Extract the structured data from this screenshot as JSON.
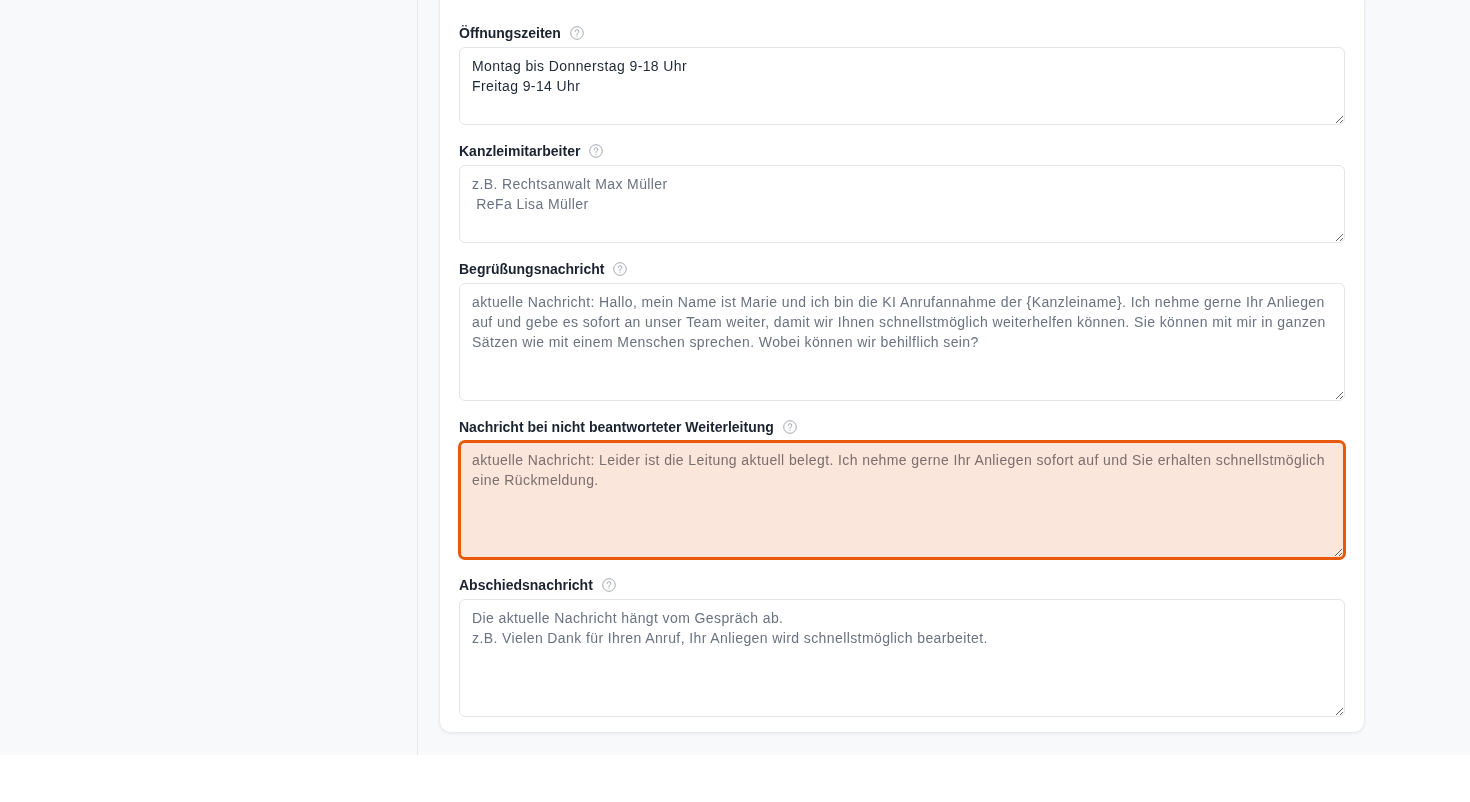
{
  "fields": [
    {
      "label": "Öffnungszeiten",
      "value": "Montag bis Donnerstag 9-18 Uhr\nFreitag 9-14 Uhr",
      "highlighted": false
    },
    {
      "label": "Kanzleimitarbeiter",
      "placeholder": "z.B. Rechtsanwalt Max Müller\n ReFa Lisa Müller",
      "highlighted": false
    },
    {
      "label": "Begrüßungsnachricht",
      "placeholder": "aktuelle Nachricht: Hallo, mein Name ist Marie und ich bin die KI Anrufannahme der {Kanzleiname}. Ich nehme gerne Ihr Anliegen auf und gebe es sofort an unser Team weiter, damit wir Ihnen schnellstmöglich weiterhelfen können. Sie können mit mir in ganzen Sätzen wie mit einem Menschen sprechen. Wobei können wir behilflich sein?",
      "highlighted": false
    },
    {
      "label": "Nachricht bei nicht beantworteter Weiterleitung",
      "placeholder": "aktuelle Nachricht: Leider ist die Leitung aktuell belegt. Ich nehme gerne Ihr Anliegen sofort auf und Sie erhalten schnellstmöglich eine Rückmeldung.",
      "highlighted": true
    },
    {
      "label": "Abschiedsnachricht",
      "placeholder": "Die aktuelle Nachricht hängt vom Gespräch ab.\nz.B. Vielen Dank für Ihren Anruf, Ihr Anliegen wird schnellstmöglich bearbeitet.",
      "highlighted": false
    }
  ]
}
